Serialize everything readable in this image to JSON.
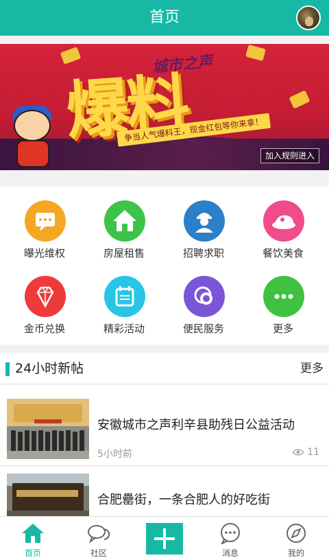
{
  "header": {
    "title": "首页"
  },
  "banner": {
    "headline": "爆料",
    "subtitle": "城市之声",
    "slogan": "争当人气爆料王，现金红包等你来拿！",
    "rule_button": "加入规则进入"
  },
  "categories": [
    {
      "label": "曝光维权",
      "icon": "chat-bubble-icon",
      "color": "#f5a623"
    },
    {
      "label": "房屋租售",
      "icon": "house-icon",
      "color": "#3cc448"
    },
    {
      "label": "招聘求职",
      "icon": "worker-icon",
      "color": "#2b80c9"
    },
    {
      "label": "餐饮美食",
      "icon": "food-icon",
      "color": "#ef4c8c"
    },
    {
      "label": "金币兑换",
      "icon": "diamond-icon",
      "color": "#ee3a3a"
    },
    {
      "label": "精彩活动",
      "icon": "calendar-icon",
      "color": "#28c6e6"
    },
    {
      "label": "便民服务",
      "icon": "service-icon",
      "color": "#7b55d8"
    },
    {
      "label": "更多",
      "icon": "more-icon",
      "color": "#3ec23f"
    }
  ],
  "section": {
    "title": "24小时新帖",
    "more": "更多"
  },
  "posts": [
    {
      "title": "安徽城市之声利辛县助残日公益活动",
      "time": "5小时前",
      "views": "11"
    },
    {
      "title": "合肥罍街，一条合肥人的好吃街",
      "time": "",
      "views": ""
    }
  ],
  "tabs": [
    {
      "label": "首页",
      "icon": "home-icon"
    },
    {
      "label": "社区",
      "icon": "community-icon"
    },
    {
      "label": "",
      "icon": "plus-icon"
    },
    {
      "label": "消息",
      "icon": "message-icon"
    },
    {
      "label": "我的",
      "icon": "compass-icon"
    }
  ],
  "colors": {
    "accent": "#17b9a5"
  }
}
